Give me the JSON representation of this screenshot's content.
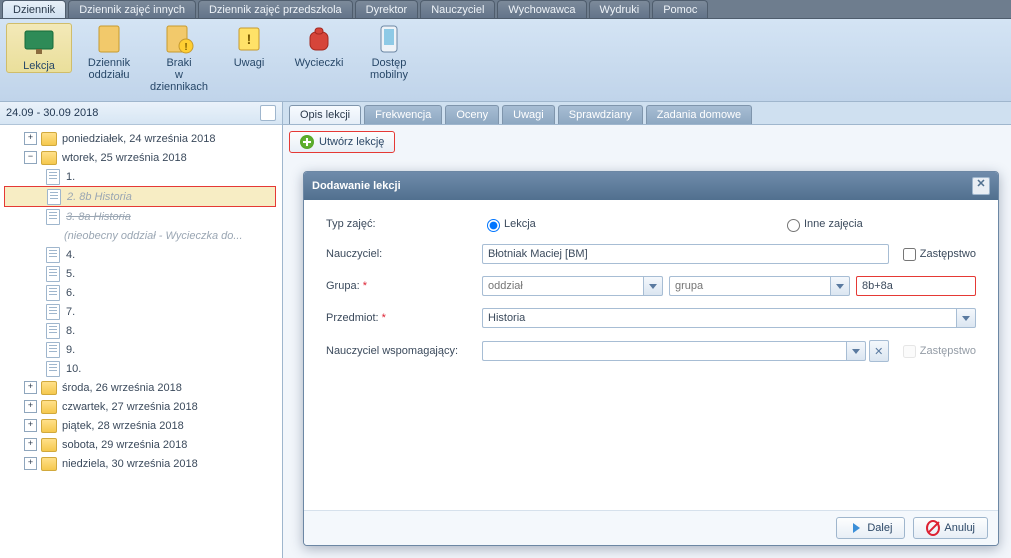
{
  "menu_tabs": [
    "Dziennik",
    "Dziennik zajęć innych",
    "Dziennik zajęć przedszkola",
    "Dyrektor",
    "Nauczyciel",
    "Wychowawca",
    "Wydruki",
    "Pomoc"
  ],
  "menu_active_index": 0,
  "ribbon": [
    {
      "label": "Lekcja",
      "active": true,
      "icon": "board"
    },
    {
      "label": "Dziennik oddziału",
      "icon": "book"
    },
    {
      "label": "Braki w dziennikach",
      "icon": "book-warn"
    },
    {
      "label": "Uwagi",
      "icon": "note"
    },
    {
      "label": "Wycieczki",
      "icon": "backpack"
    },
    {
      "label": "Dostęp mobilny",
      "icon": "mobile"
    }
  ],
  "sidebar": {
    "date_range": "24.09 - 30.09 2018",
    "tree": [
      {
        "type": "day",
        "expanded": false,
        "label": "poniedziałek, 24 września 2018"
      },
      {
        "type": "day",
        "expanded": true,
        "label": "wtorek, 25 września 2018",
        "children": [
          {
            "label": "1."
          },
          {
            "label": "2. 8b Historia",
            "selected": true,
            "muted": true
          },
          {
            "label": "3. 8a Historia",
            "muted": true,
            "strike": true,
            "sub": "(nieobecny oddział - Wycieczka do..."
          },
          {
            "label": "4."
          },
          {
            "label": "5."
          },
          {
            "label": "6."
          },
          {
            "label": "7."
          },
          {
            "label": "8."
          },
          {
            "label": "9."
          },
          {
            "label": "10."
          }
        ]
      },
      {
        "type": "day",
        "expanded": false,
        "label": "środa, 26 września 2018"
      },
      {
        "type": "day",
        "expanded": false,
        "label": "czwartek, 27 września 2018"
      },
      {
        "type": "day",
        "expanded": false,
        "label": "piątek, 28 września 2018"
      },
      {
        "type": "day",
        "expanded": false,
        "label": "sobota, 29 września 2018"
      },
      {
        "type": "day",
        "expanded": false,
        "label": "niedziela, 30 września 2018"
      }
    ]
  },
  "content": {
    "sub_tabs": [
      "Opis lekcji",
      "Frekwencja",
      "Oceny",
      "Uwagi",
      "Sprawdziany",
      "Zadania domowe"
    ],
    "sub_active_index": 0,
    "create_button": "Utwórz lekcję"
  },
  "dialog": {
    "title": "Dodawanie lekcji",
    "labels": {
      "typ": "Typ zajęć:",
      "lekcja": "Lekcja",
      "inne": "Inne zajęcia",
      "nauczyciel": "Nauczyciel:",
      "zastepstwo": "Zastępstwo",
      "grupa": "Grupa:",
      "przedmiot": "Przedmiot:",
      "nw": "Nauczyciel wspomagający:"
    },
    "values": {
      "nauczyciel": "Błotniak Maciej [BM]",
      "oddzial_placeholder": "oddział",
      "grupa_placeholder": "grupa",
      "rooms": "8b+8a",
      "przedmiot": "Historia",
      "nw": ""
    },
    "buttons": {
      "next": "Dalej",
      "cancel": "Anuluj"
    }
  }
}
